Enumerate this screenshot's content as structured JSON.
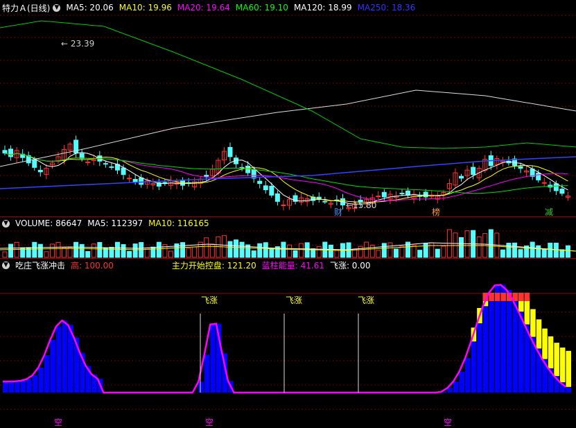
{
  "main": {
    "title": "特力Ａ(日线)",
    "ma": [
      {
        "label": "MA5: 20.06",
        "color": "#ffffff"
      },
      {
        "label": "MA10: 19.96",
        "color": "#ffff00"
      },
      {
        "label": "MA20: 19.64",
        "color": "#ff00ff"
      },
      {
        "label": "MA60: 19.10",
        "color": "#00ff00"
      },
      {
        "label": "MA120: 18.99",
        "color": "#ffffff"
      },
      {
        "label": "MA250: 18.36",
        "color": "#3333ff"
      }
    ],
    "high_label": "23.39",
    "low_label": "15.80",
    "markers": [
      {
        "text": "财",
        "color": "#3399ff"
      },
      {
        "text": "榜",
        "color": "#ff9933"
      },
      {
        "text": "减",
        "color": "#33cc33"
      }
    ]
  },
  "volume": {
    "label": "VOLUME: 86647",
    "ma5": "MA5: 112397",
    "ma10": "MA10: 116165"
  },
  "indicator": {
    "title": "吃庄飞涨冲击",
    "high": "高: 100.00",
    "control": "主力开始控盘: 121.20",
    "energy": "蓝柱能量: 41.61",
    "fly": "飞涨: 0.00",
    "fly_tag": "飞涨",
    "empty_tag": "空"
  },
  "colors": {
    "up": "#ff3232",
    "down": "#54fcfc",
    "blue_bar": "#0000ff",
    "yellow_bar": "#ffff00",
    "magenta": "#ff00ff"
  },
  "chart_data": {
    "type": "candlestick",
    "title": "特力Ａ(日线)",
    "high": 23.39,
    "low": 15.8
  }
}
